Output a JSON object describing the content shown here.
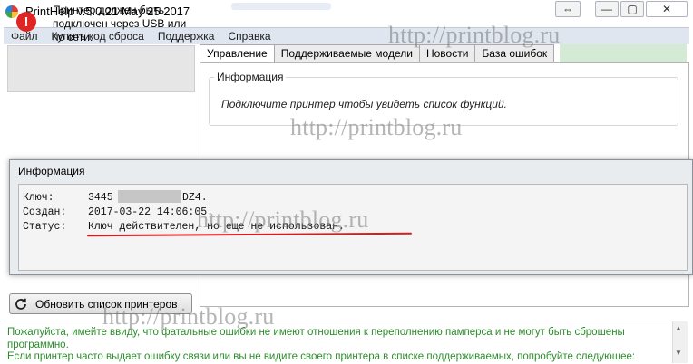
{
  "window": {
    "title": "PrintHelp v.5.0.21 May 25 2017",
    "controls": {
      "swap": "⇔",
      "minimize": "—",
      "maximize": "▢",
      "close": "✕"
    }
  },
  "menu": [
    "Файл",
    "Купить код сброса",
    "Поддержка",
    "Справка"
  ],
  "left_panel": {
    "warning_icon": "exclamation-icon",
    "warning_text": "Принтер должен быть подключен через USB или по сети."
  },
  "tabs": [
    "Управление",
    "Поддерживаемые модели",
    "Новости",
    "База ошибок"
  ],
  "info_group": {
    "title": "Информация",
    "message": "Подключите принтер чтобы увидеть список функций."
  },
  "dialog": {
    "title": "Информация",
    "rows": {
      "key_label": "Ключ:",
      "key_value_start": "3445",
      "key_value_end": "DZ4.",
      "created_label": "Создан:",
      "created_value": "2017-03-22 14:06:05.",
      "status_label": "Статус:",
      "status_value": "Ключ действителен, но еще не использован."
    }
  },
  "refresh_button": {
    "label": "Обновить список принтеров",
    "icon": "refresh-icon"
  },
  "bottom_text": {
    "line1": "Пожалуйста, имейте ввиду, что фатальные ошибки не имеют отношения к переполнению памперса и не могут быть сброшены программно.",
    "line2": "Если принтер часто выдает ошибку связи или вы не видите своего принтера в списке поддерживаемых, попробуйте следующее:"
  },
  "watermark": "http://printblog.ru",
  "colors": {
    "warning": "#e02424",
    "underline": "#d81b1b",
    "bottom_text": "#2e8b2e"
  }
}
